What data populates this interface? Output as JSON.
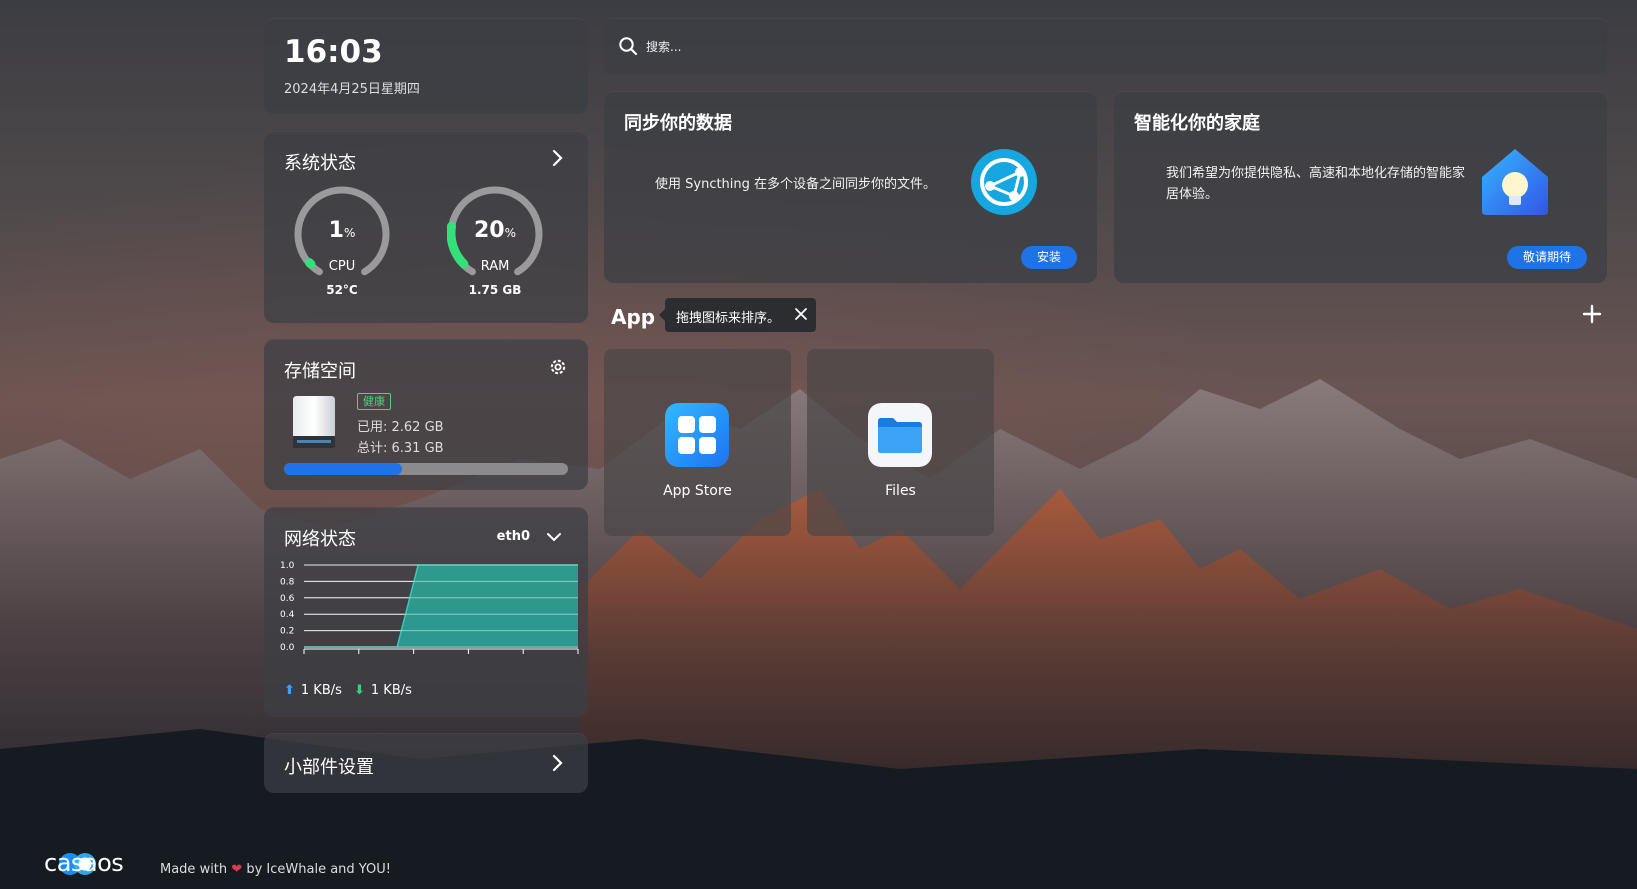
{
  "clock": {
    "time": "16:03",
    "date": "2024年4月25日星期四"
  },
  "system_status": {
    "title": "系统状态",
    "cpu": {
      "percent": 1,
      "value": "1",
      "unit": "%",
      "label": "CPU",
      "temp": "52°C",
      "color": "#33e07a"
    },
    "ram": {
      "percent": 20,
      "value": "20",
      "unit": "%",
      "label": "RAM",
      "used": "1.75 GB",
      "color": "#33e07a"
    }
  },
  "storage": {
    "title": "存储空间",
    "health": "健康",
    "used": "已用: 2.62 GB",
    "total": "总计: 6.31 GB",
    "used_fraction": 0.415,
    "bar_color": "#1e73e8"
  },
  "network": {
    "title": "网络状态",
    "interface": "eth0",
    "chart_data": {
      "type": "area",
      "ylim": [
        0,
        1.0
      ],
      "y_ticks": [
        "1.0",
        "0.8",
        "0.6",
        "0.4",
        "0.2",
        "0.0"
      ],
      "x_tick_count": 6,
      "series": [
        {
          "values": [
            0,
            0,
            0,
            0,
            0,
            1,
            1,
            1,
            1,
            1,
            1,
            1,
            1
          ],
          "color": "#2aa89a"
        }
      ]
    },
    "upload": "1 KB/s",
    "download": "1 KB/s",
    "upload_arrow": "⬆",
    "download_arrow": "⬇"
  },
  "widget_settings": {
    "title": "小部件设置"
  },
  "search": {
    "placeholder": "搜索..."
  },
  "promo_sync": {
    "title": "同步你的数据",
    "text": "使用 Syncthing 在多个设备之间同步你的文件。",
    "button": "安装"
  },
  "promo_home": {
    "title": "智能化你的家庭",
    "text": "我们希望为你提供隐私、高速和本地化存储的智能家居体验。",
    "button": "敬请期待"
  },
  "apps": {
    "heading": "App",
    "tooltip": "拖拽图标来排序。",
    "items": [
      {
        "label": "App Store",
        "icon": "app-store-icon"
      },
      {
        "label": "Files",
        "icon": "folder-icon"
      }
    ]
  },
  "footer": {
    "logo": "casaos",
    "made_with": "Made with",
    "by": "by IceWhale and YOU!"
  }
}
